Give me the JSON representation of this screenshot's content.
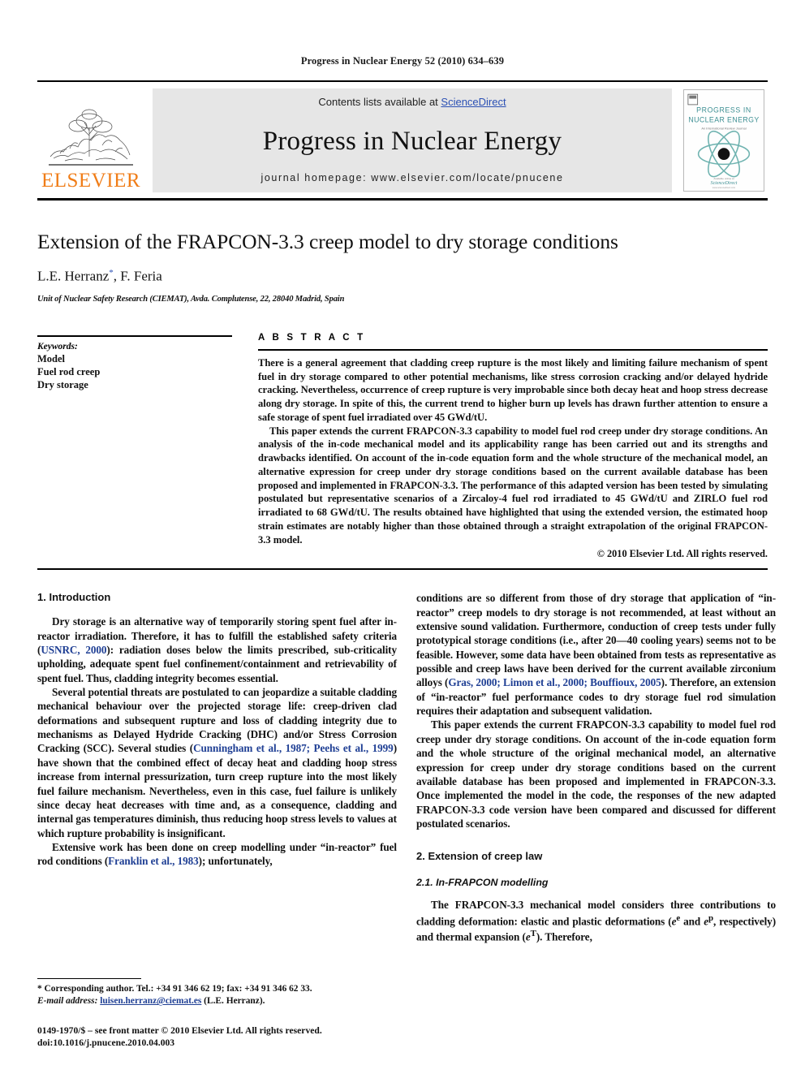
{
  "running_head": "Progress in Nuclear Energy 52 (2010) 634–639",
  "banner": {
    "contents_prefix": "Contents lists available at ",
    "sciencedirect": "ScienceDirect",
    "journal_name": "Progress in Nuclear Energy",
    "homepage": "journal homepage: www.elsevier.com/locate/pnucene",
    "elsevier_wordmark": "ELSEVIER",
    "cover": {
      "line1": "PROGRESS IN",
      "line2": "NUCLEAR ENERGY",
      "line3": "An International Review Journal",
      "footer": "ScienceDirect",
      "accent_color": "#5aa8a8",
      "text_color": "#3d8f93"
    },
    "link_color": "#2b50b4",
    "elsevier_color": "#f07d18"
  },
  "title_block": {
    "title": "Extension of the FRAPCON-3.3 creep model to dry storage conditions",
    "authors": "L.E. Herranz",
    "corresponding_mark": "*",
    "authors_tail": ", F. Feria",
    "affiliation": "Unit of Nuclear Safety Research (CIEMAT), Avda. Complutense, 22, 28040 Madrid, Spain"
  },
  "keywords": {
    "heading": "Keywords:",
    "items": [
      "Model",
      "Fuel rod creep",
      "Dry storage"
    ]
  },
  "abstract": {
    "heading": "A B S T R A C T",
    "paragraphs": [
      "There is a general agreement that cladding creep rupture is the most likely and limiting failure mechanism of spent fuel in dry storage compared to other potential mechanisms, like stress corrosion cracking and/or delayed hydride cracking. Nevertheless, occurrence of creep rupture is very improbable since both decay heat and hoop stress decrease along dry storage. In spite of this, the current trend to higher burn up levels has drawn further attention to ensure a safe storage of spent fuel irradiated over 45 GWd/tU.",
      "This paper extends the current FRAPCON-3.3 capability to model fuel rod creep under dry storage conditions. An analysis of the in-code mechanical model and its applicability range has been carried out and its strengths and drawbacks identified. On account of the in-code equation form and the whole structure of the mechanical model, an alternative expression for creep under dry storage conditions based on the current available database has been proposed and implemented in FRAPCON-3.3. The performance of this adapted version has been tested by simulating postulated but representative scenarios of a Zircaloy-4 fuel rod irradiated to 45 GWd/tU and ZIRLO fuel rod irradiated to 68 GWd/tU. The results obtained have highlighted that using the extended version, the estimated hoop strain estimates are notably higher than those obtained through a straight extrapolation of the original FRAPCON-3.3 model."
    ],
    "copyright": "© 2010 Elsevier Ltd. All rights reserved."
  },
  "body": {
    "section1_heading": "1. Introduction",
    "left_paragraphs": [
      {
        "pre": "Dry storage is an alternative way of temporarily storing spent fuel after in-reactor irradiation. Therefore, it has to fulfill the established safety criteria (",
        "ref": "USNRC, 2000",
        "post": "): radiation doses below the limits prescribed, sub-criticality upholding, adequate spent fuel confinement/containment and retrievability of spent fuel. Thus, cladding integrity becomes essential."
      },
      {
        "pre": "Several potential threats are postulated to can jeopardize a suitable cladding mechanical behaviour over the projected storage life: creep-driven clad deformations and subsequent rupture and loss of cladding integrity due to mechanisms as Delayed Hydride Cracking (DHC) and/or Stress Corrosion Cracking (SCC). Several studies (",
        "ref": "Cunningham et al., 1987; Peehs et al., 1999",
        "post": ") have shown that the combined effect of decay heat and cladding hoop stress increase from internal pressurization, turn creep rupture into the most likely fuel failure mechanism. Nevertheless, even in this case, fuel failure is unlikely since decay heat decreases with time and, as a consequence, cladding and internal gas temperatures diminish, thus reducing hoop stress levels to values at which rupture probability is insignificant."
      },
      {
        "pre": "Extensive work has been done on creep modelling under “in-reactor” fuel rod conditions (",
        "ref": "Franklin et al., 1983",
        "post": "); unfortunately,"
      }
    ],
    "right_paragraphs": [
      {
        "pre": "conditions are so different from those of dry storage that application of “in-reactor” creep models to dry storage is not recommended, at least without an extensive sound validation. Furthermore, conduction of creep tests under fully prototypical storage conditions (i.e., after 20—40 cooling years) seems not to be feasible. However, some data have been obtained from tests as representative as possible and creep laws have been derived for the current available zirconium alloys (",
        "ref": "Gras, 2000; Limon et al., 2000; Bouffioux, 2005",
        "post": "). Therefore, an extension of “in-reactor” fuel performance codes to dry storage fuel rod simulation requires their adaptation and subsequent validation."
      },
      {
        "pre": "This paper extends the current FRAPCON-3.3 capability to model fuel rod creep under dry storage conditions. On account of the in-code equation form and the whole structure of the original mechanical model, an alternative expression for creep under dry storage conditions based on the current available database has been proposed and implemented in FRAPCON-3.3. Once implemented the model in the code, the responses of the new adapted FRAPCON-3.3 code version have been compared and discussed for different postulated scenarios.",
        "ref": "",
        "post": ""
      }
    ],
    "section2_heading": "2. Extension of creep law",
    "subsection21_heading": "2.1. In-FRAPCON modelling",
    "right_last_paragraph_pre": "The FRAPCON-3.3 mechanical model considers three contributions to cladding deformation: elastic and plastic deformations (",
    "right_last_paragraph_mid1": " and ",
    "right_last_paragraph_mid2": ", respectively) and thermal expansion (",
    "right_last_paragraph_post": "). Therefore,",
    "symbols": {
      "elastic": "e",
      "elastic_sup": "e",
      "plastic": "e",
      "plastic_sup": "p",
      "thermal": "e",
      "thermal_sup": "T"
    }
  },
  "footnotes": {
    "corresponding": "* Corresponding author. Tel.: +34 91 346 62 19; fax: +34 91 346 62 33.",
    "email_label": "E-mail address:",
    "email": "luisen.herranz@ciemat.es",
    "email_suffix": " (L.E. Herranz).",
    "issn_line": "0149-1970/$ – see front matter © 2010 Elsevier Ltd. All rights reserved.",
    "doi_line": "doi:10.1016/j.pnucene.2010.04.003"
  }
}
